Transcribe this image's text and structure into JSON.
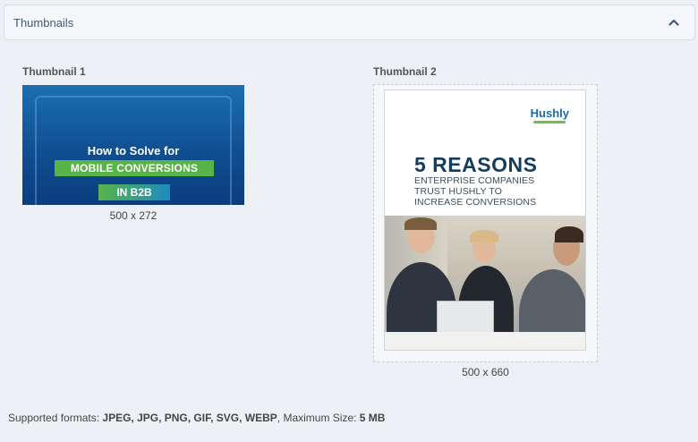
{
  "panel": {
    "title": "Thumbnails"
  },
  "thumbnails": [
    {
      "label": "Thumbnail 1",
      "size": "500 x 272",
      "image": {
        "line1": "How to Solve for",
        "line2": "MOBILE CONVERSIONS",
        "line3": "IN B2B"
      }
    },
    {
      "label": "Thumbnail 2",
      "size": "500 x 660",
      "image": {
        "logo": "Hushly",
        "headline": "5 REASONS",
        "sub1": "ENTERPRISE COMPANIES",
        "sub2": "TRUST HUSHLY TO",
        "sub3": "INCREASE CONVERSIONS"
      }
    }
  ],
  "footer": {
    "prefix": "Supported formats: ",
    "formats": "JPEG, JPG, PNG, GIF, SVG, WEBP",
    "middle": ", Maximum Size: ",
    "max_size": "5 MB"
  },
  "colors": {
    "accent": "#3f5a78",
    "green": "#58b449",
    "navy": "#153d5a"
  }
}
